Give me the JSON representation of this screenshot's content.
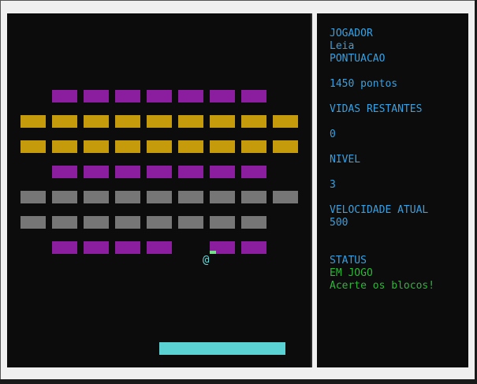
{
  "game": {
    "colors": {
      "purple": "#8b1e9e",
      "gold": "#c59b0c",
      "gray": "#767676",
      "paddle": "#5ad2d4",
      "hud_label": "#3aa0e0",
      "hud_status": "#2fb53a"
    },
    "ball_glyph": "@",
    "brick_rows": [
      [
        "purple",
        "purple",
        "purple",
        "purple",
        "purple",
        "purple",
        "purple"
      ],
      [
        "gold",
        "gold",
        "gold",
        "gold",
        "gold",
        "gold",
        "gold",
        "gold",
        "gold"
      ],
      [
        "gold",
        "gold",
        "gold",
        "gold",
        "gold",
        "gold",
        "gold",
        "gold",
        "gold"
      ],
      [
        "purple",
        "purple",
        "purple",
        "purple",
        "purple",
        "purple",
        "purple"
      ],
      [
        "gray",
        "gray",
        "gray",
        "gray",
        "gray",
        "gray",
        "gray",
        "gray",
        "gray"
      ],
      [
        "gray",
        "gray",
        "gray",
        "gray",
        "gray",
        "gray",
        "gray",
        "gray"
      ],
      [
        "purple",
        "purple",
        "purple",
        "purple",
        "purple",
        "purple"
      ]
    ]
  },
  "hud": {
    "player_label": "JOGADOR",
    "player_name": "Leia",
    "score_label": "PONTUACAO",
    "score_value": "1450 pontos",
    "lives_label": "VIDAS RESTANTES",
    "lives_value": "0",
    "level_label": "NIVEL",
    "level_value": "3",
    "speed_label": "VELOCIDADE ATUAL",
    "speed_value": "500",
    "status_label": "STATUS",
    "status_value": "EM JOGO",
    "status_message": "Acerte os blocos!"
  }
}
